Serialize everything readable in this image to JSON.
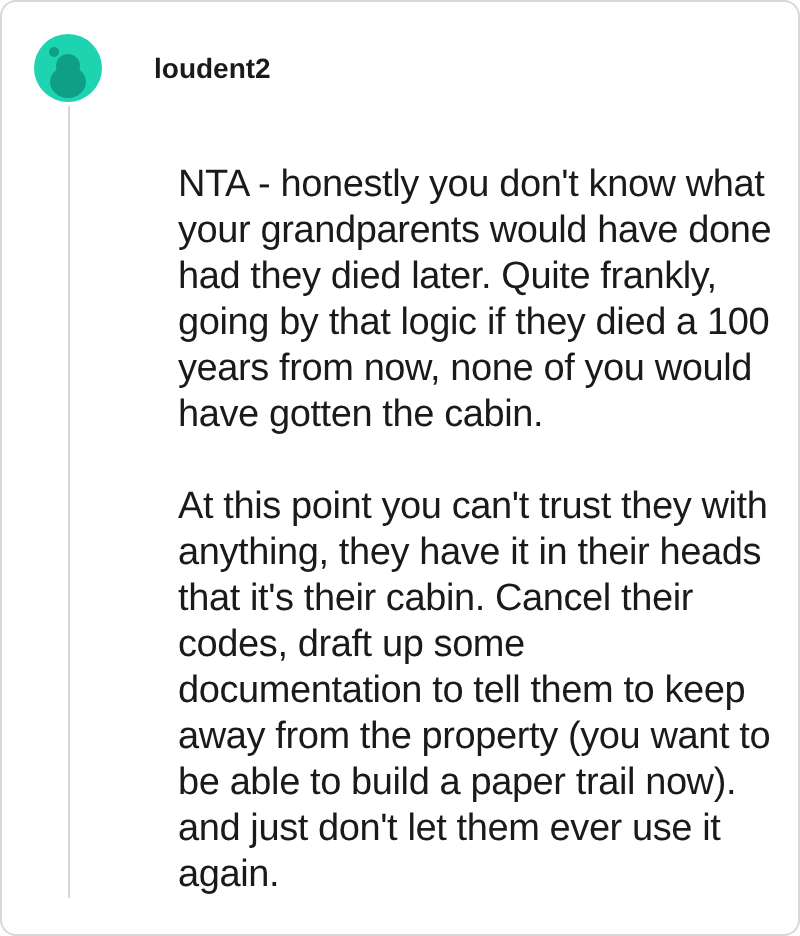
{
  "comment": {
    "author": "loudent2",
    "paragraphs": [
      "NTA - honestly you don't know what your grandparents would have done had they died later. Quite frankly, going by that logic if they died a 100 years from now, none of you would have gotten the cabin.",
      "At this point you can't trust they with anything, they have it in their heads that it's their cabin. Cancel their codes, draft up some documentation to tell them to keep away from the property (you want to be able to build a paper trail now). and just don't let them ever use it again."
    ]
  }
}
